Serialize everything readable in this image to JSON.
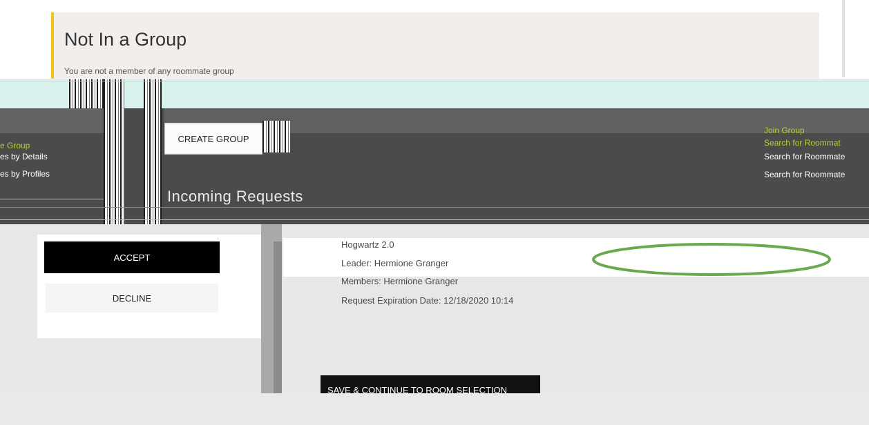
{
  "notice": {
    "title": "Not In a Group",
    "body": "You are not a member of any roommate group"
  },
  "toolbar": {
    "create_group_label": "CREATE GROUP"
  },
  "left_links": [
    {
      "label": "e Group"
    },
    {
      "label": "es by Details"
    },
    {
      "label": "es by Profiles"
    }
  ],
  "right_links": [
    {
      "label": "Join Group"
    },
    {
      "label": "Search for Roommat"
    },
    {
      "label": "Search for Roommate"
    },
    {
      "label": "Search for Roommate"
    }
  ],
  "incoming": {
    "title": "Incoming Requests"
  },
  "request": {
    "accept_label": "ACCEPT",
    "decline_label": "DECLINE",
    "group_name": "Hogwartz 2.0",
    "leader": "Leader: Hermione Granger",
    "members": "Members: Hermione Granger",
    "expiration": "Request Expiration Date: 12/18/2020 10:14"
  },
  "footer": {
    "save_label": "SAVE & CONTINUE TO ROOM SELECTION"
  },
  "colors": {
    "accent_yellow": "#f0c419",
    "link_green": "#b6d432",
    "highlight_green": "#6aa84f",
    "dark_band": "#4b4b4b"
  }
}
